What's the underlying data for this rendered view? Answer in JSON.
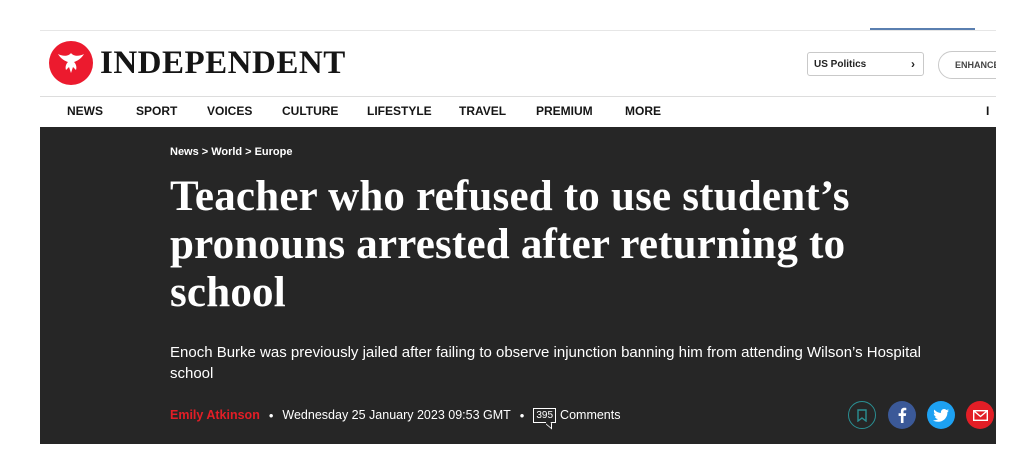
{
  "header": {
    "brand": "INDEPENDENT",
    "us_politics_label": "US Politics",
    "enhanced_label": "ENHANCE"
  },
  "nav": {
    "items": [
      "NEWS",
      "SPORT",
      "VOICES",
      "CULTURE",
      "LIFESTYLE",
      "TRAVEL",
      "PREMIUM",
      "MORE"
    ],
    "cut_label": "I"
  },
  "article": {
    "breadcrumb": [
      "News",
      "World",
      "Europe"
    ],
    "breadcrumb_sep": ">",
    "headline": "Teacher who refused to use student’s pronouns arrested after returning to school",
    "standfirst": "Enoch Burke was previously jailed after failing to observe injunction banning him from attending Wilson’s Hospital school",
    "author": "Emily Atkinson",
    "date": "Wednesday 25 January 2023 09:53 GMT",
    "comment_count": "395",
    "comments_label": "Comments",
    "byline_separator": "•"
  },
  "share_icons": [
    "bookmark-icon",
    "facebook-icon",
    "twitter-icon",
    "email-icon"
  ],
  "colors": {
    "brand_red": "#ec1a2e",
    "hero_bg": "#262626",
    "author_red": "#e21e26",
    "facebook": "#3b5998",
    "twitter": "#1da1f2",
    "bookmark_ring": "#2a8f93"
  }
}
